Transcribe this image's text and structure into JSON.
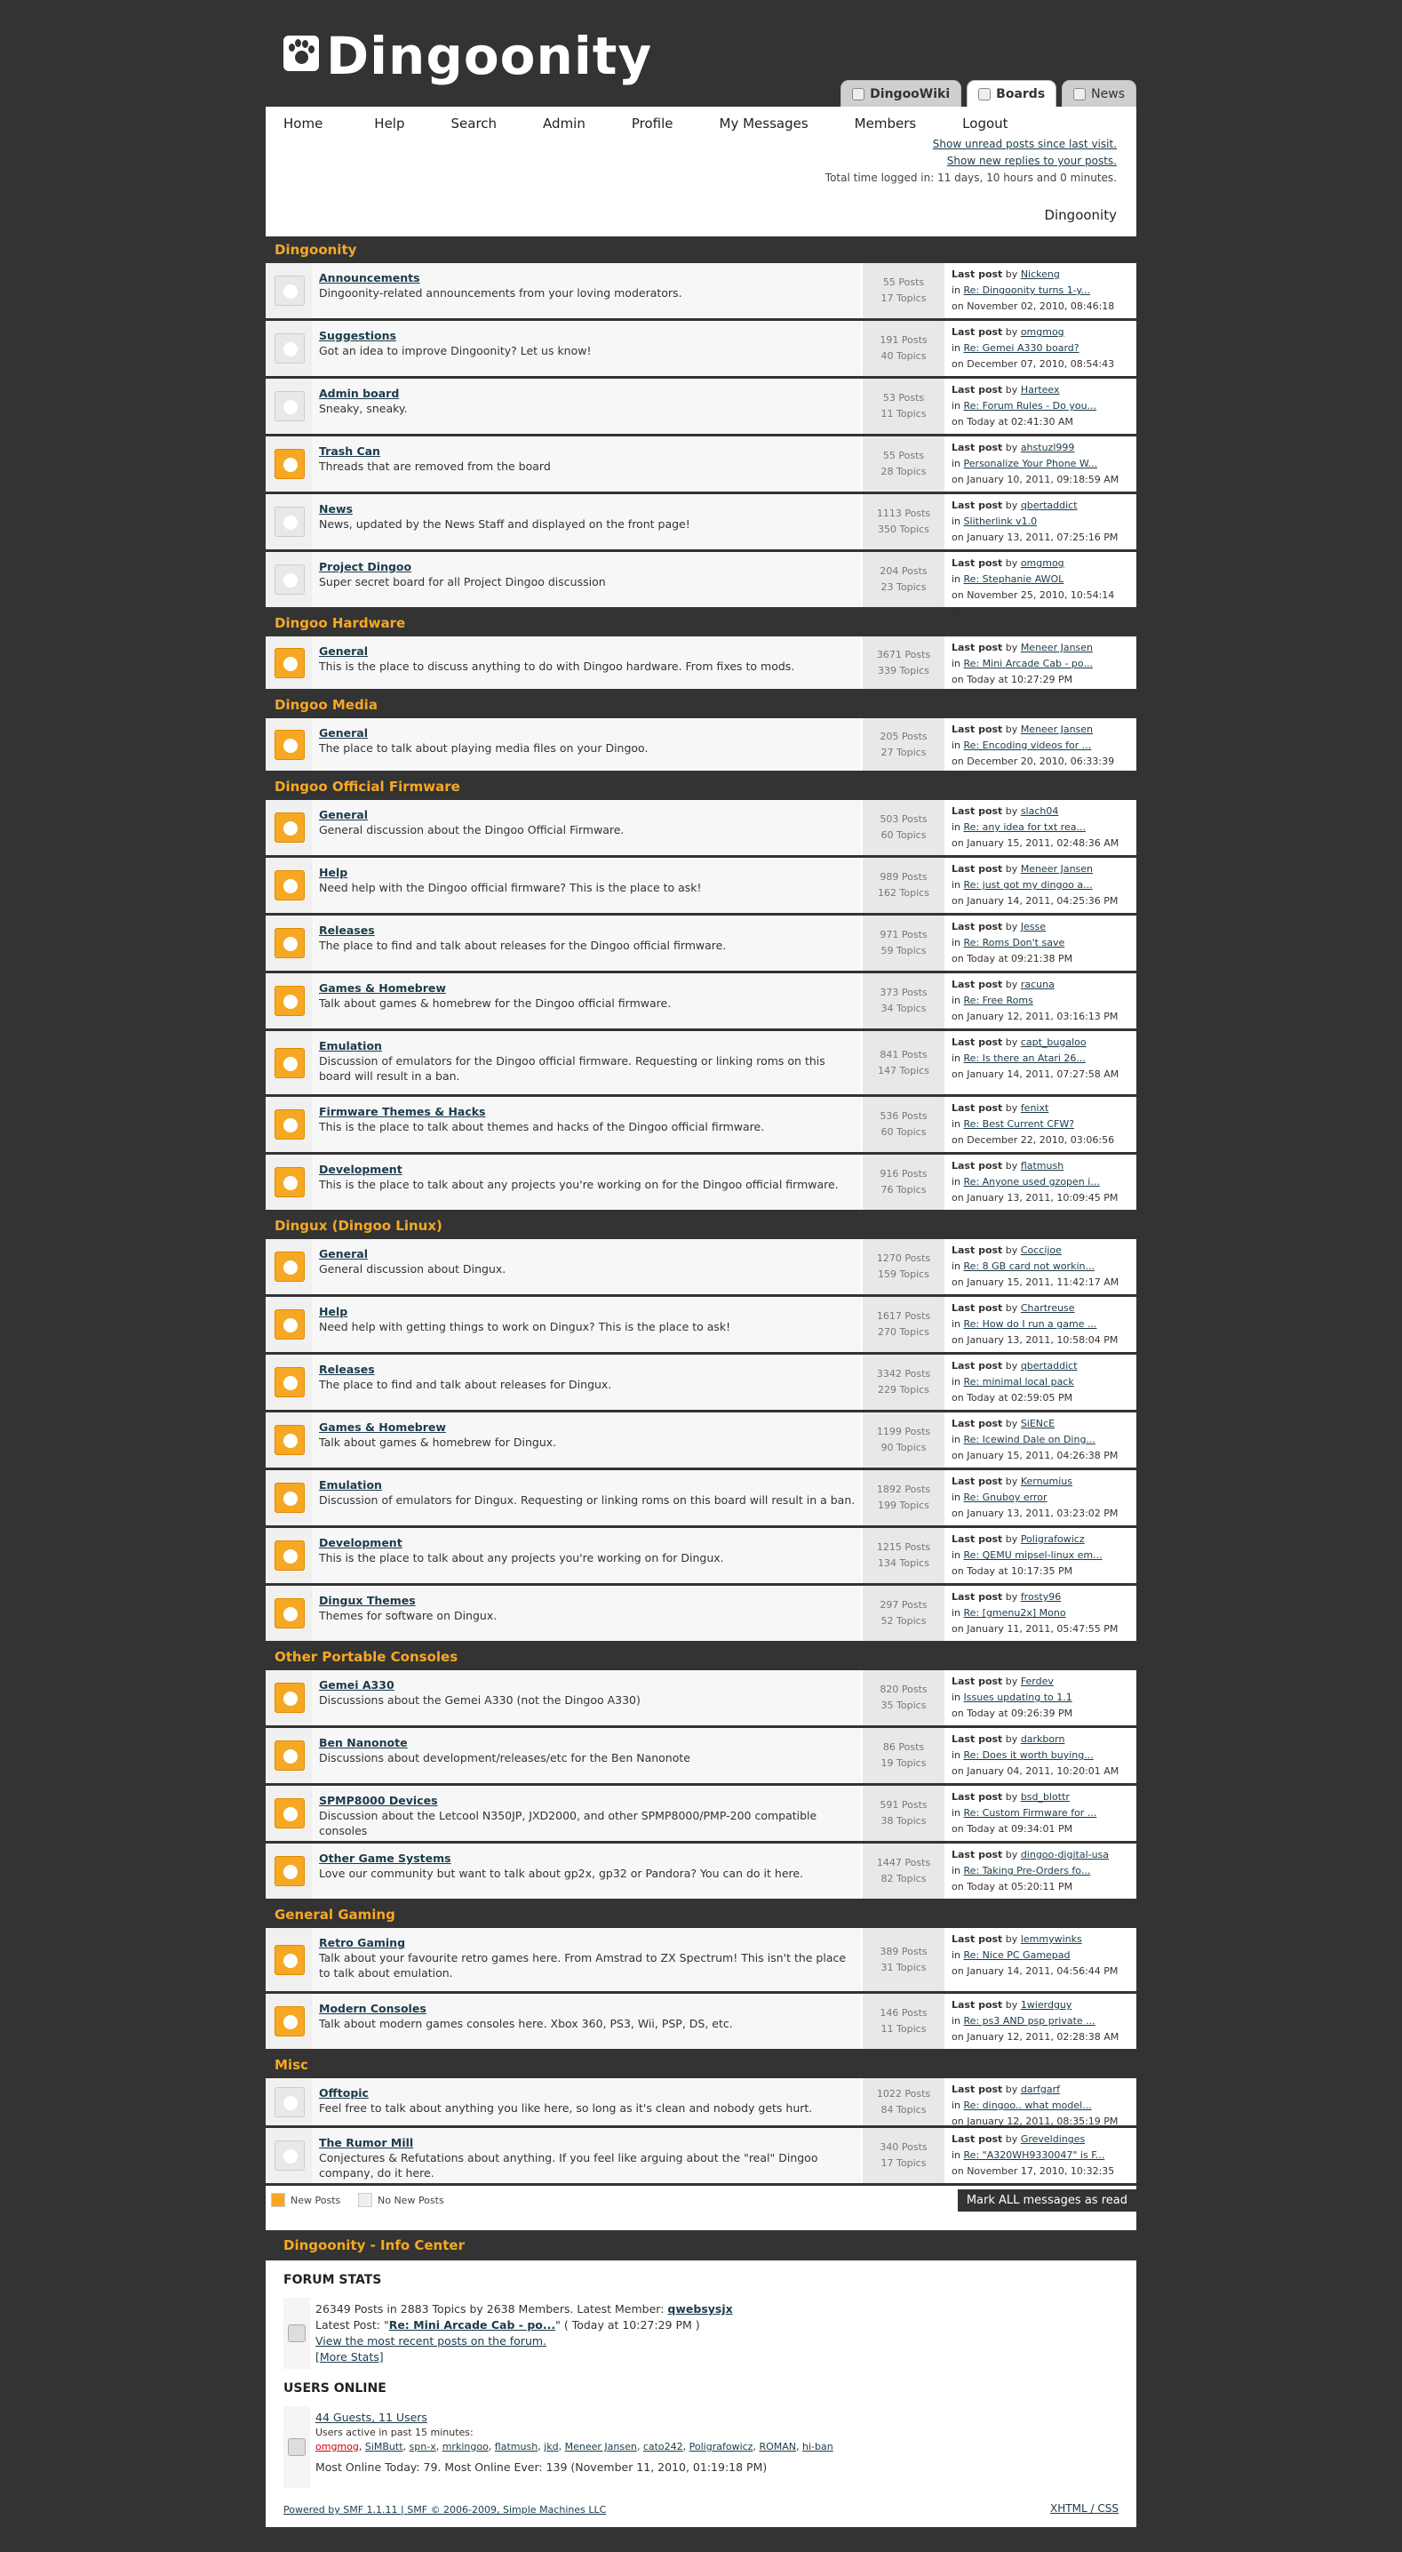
{
  "site": {
    "title": "Dingoonity"
  },
  "site_tabs": [
    "DingooWiki",
    "Boards",
    "News"
  ],
  "menu": [
    "Home",
    "Help",
    "Search",
    "Admin",
    "Profile",
    "My Messages",
    "Members",
    "Logout"
  ],
  "top": {
    "unread": "Show unread posts since last visit.",
    "replies": "Show new replies to your posts.",
    "time": "Total time logged in: 11 days, 10 hours and 0 minutes.",
    "crumb": "Dingoonity"
  },
  "last_post_label": "Last post",
  "categories": [
    {
      "name": "Dingoonity",
      "boards": [
        {
          "name": "Announcements",
          "desc": "Dingoonity-related announcements from your loving moderators.",
          "posts": "55 Posts",
          "topics": "17 Topics",
          "user": "Nickeng",
          "topic": "Re: Dingoonity turns 1-y...",
          "date": "on November 02, 2010, 08:46:18 AM",
          "new": false
        },
        {
          "name": "Suggestions",
          "desc": "Got an idea to improve Dingoonity? Let us know!",
          "posts": "191 Posts",
          "topics": "40 Topics",
          "user": "omgmog",
          "topic": "Re: Gemei A330 board?",
          "date": "on December 07, 2010, 08:54:43 AM",
          "new": false
        },
        {
          "name": "Admin board",
          "desc": "Sneaky, sneaky.",
          "posts": "53 Posts",
          "topics": "11 Topics",
          "user": "Harteex",
          "topic": "Re: Forum Rules - Do you...",
          "date": "on Today at 02:41:30 AM",
          "new": false
        },
        {
          "name": "Trash Can",
          "desc": "Threads that are removed from the board",
          "posts": "55 Posts",
          "topics": "28 Topics",
          "user": "ahstuzl999",
          "topic": "Personalize Your Phone W...",
          "date": "on January 10, 2011, 09:18:59 AM",
          "new": true
        },
        {
          "name": "News",
          "desc": "News, updated by the News Staff and displayed on the front page!",
          "posts": "1113 Posts",
          "topics": "350 Topics",
          "user": "qbertaddict",
          "topic": "Slitherlink v1.0",
          "date": "on January 13, 2011, 07:25:16 PM",
          "new": false
        },
        {
          "name": "Project Dingoo",
          "desc": "Super secret board for all Project Dingoo discussion",
          "posts": "204 Posts",
          "topics": "23 Topics",
          "user": "omgmog",
          "topic": "Re: Stephanie AWOL",
          "date": "on November 25, 2010, 10:54:14 PM",
          "new": false
        }
      ]
    },
    {
      "name": "Dingoo Hardware",
      "boards": [
        {
          "name": "General",
          "desc": "This is the place to discuss anything to do with Dingoo hardware. From fixes to mods.",
          "posts": "3671 Posts",
          "topics": "339 Topics",
          "user": "Meneer Jansen",
          "topic": "Re: Mini Arcade Cab - po...",
          "date": "on Today at 10:27:29 PM",
          "new": true
        }
      ]
    },
    {
      "name": "Dingoo Media",
      "boards": [
        {
          "name": "General",
          "desc": "The place to talk about playing media files on your Dingoo.",
          "posts": "205 Posts",
          "topics": "27 Topics",
          "user": "Meneer Jansen",
          "topic": "Re: Encoding videos for ...",
          "date": "on December 20, 2010, 06:33:39 PM",
          "new": true
        }
      ]
    },
    {
      "name": "Dingoo Official Firmware",
      "boards": [
        {
          "name": "General",
          "desc": "General discussion about the Dingoo Official Firmware.",
          "posts": "503 Posts",
          "topics": "60 Topics",
          "user": "slach04",
          "topic": "Re: any idea for txt rea...",
          "date": "on January 15, 2011, 02:48:36 AM",
          "new": true
        },
        {
          "name": "Help",
          "desc": "Need help with the Dingoo official firmware? This is the place to ask!",
          "posts": "989 Posts",
          "topics": "162 Topics",
          "user": "Meneer Jansen",
          "topic": "Re: just got my dingoo a...",
          "date": "on January 14, 2011, 04:25:36 PM",
          "new": true
        },
        {
          "name": "Releases",
          "desc": "The place to find and talk about releases for the Dingoo official firmware.",
          "posts": "971 Posts",
          "topics": "59 Topics",
          "user": "Jesse",
          "topic": "Re: Roms Don't save",
          "date": "on Today at 09:21:38 PM",
          "new": true
        },
        {
          "name": "Games & Homebrew",
          "desc": "Talk about games & homebrew for the Dingoo official firmware.",
          "posts": "373 Posts",
          "topics": "34 Topics",
          "user": "racuna",
          "topic": "Re: Free Roms",
          "date": "on January 12, 2011, 03:16:13 PM",
          "new": true
        },
        {
          "name": "Emulation",
          "desc": "Discussion of emulators for the Dingoo official firmware. Requesting or linking roms on this board will result in a ban.",
          "posts": "841 Posts",
          "topics": "147 Topics",
          "user": "capt_bugaloo",
          "topic": "Re: Is there an Atari 26...",
          "date": "on January 14, 2011, 07:27:58 AM",
          "new": true
        },
        {
          "name": "Firmware Themes & Hacks",
          "desc": "This is the place to talk about themes and hacks of the Dingoo official firmware.",
          "posts": "536 Posts",
          "topics": "60 Topics",
          "user": "fenixt",
          "topic": "Re: Best Current CFW?",
          "date": "on December 22, 2010, 03:06:56 PM",
          "new": true
        },
        {
          "name": "Development",
          "desc": "This is the place to talk about any projects you're working on for the Dingoo official firmware.",
          "posts": "916 Posts",
          "topics": "76 Topics",
          "user": "flatmush",
          "topic": "Re: Anyone used gzopen i...",
          "date": "on January 13, 2011, 10:09:45 PM",
          "new": true
        }
      ]
    },
    {
      "name": "Dingux (Dingoo Linux)",
      "boards": [
        {
          "name": "General",
          "desc": "General discussion about Dingux.",
          "posts": "1270 Posts",
          "topics": "159 Topics",
          "user": "Coccijoe",
          "topic": "Re: 8 GB card not workin...",
          "date": "on January 15, 2011, 11:42:17 AM",
          "new": true
        },
        {
          "name": "Help",
          "desc": "Need help with getting things to work on Dingux? This is the place to ask!",
          "posts": "1617 Posts",
          "topics": "270 Topics",
          "user": "Chartreuse",
          "topic": "Re: How do I run a game ...",
          "date": "on January 13, 2011, 10:58:04 PM",
          "new": true
        },
        {
          "name": "Releases",
          "desc": "The place to find and talk about releases for Dingux.",
          "posts": "3342 Posts",
          "topics": "229 Topics",
          "user": "qbertaddict",
          "topic": "Re: minimal local pack",
          "date": "on Today at 02:59:05 PM",
          "new": true
        },
        {
          "name": "Games & Homebrew",
          "desc": "Talk about games & homebrew for Dingux.",
          "posts": "1199 Posts",
          "topics": "90 Topics",
          "user": "SiENcE",
          "topic": "Re: Icewind Dale on Ding...",
          "date": "on January 15, 2011, 04:26:38 PM",
          "new": true
        },
        {
          "name": "Emulation",
          "desc": "Discussion of emulators for Dingux. Requesting or linking roms on this board will result in a ban.",
          "posts": "1892 Posts",
          "topics": "199 Topics",
          "user": "Kernumius",
          "topic": "Re: Gnuboy error",
          "date": "on January 13, 2011, 03:23:02 PM",
          "new": true
        },
        {
          "name": "Development",
          "desc": "This is the place to talk about any projects you're working on for Dingux.",
          "posts": "1215 Posts",
          "topics": "134 Topics",
          "user": "Poligrafowicz",
          "topic": "Re: QEMU mipsel-linux em...",
          "date": "on Today at 10:17:35 PM",
          "new": true
        },
        {
          "name": "Dingux Themes",
          "desc": "Themes for software on Dingux.",
          "posts": "297 Posts",
          "topics": "52 Topics",
          "user": "frosty96",
          "topic": "Re: [gmenu2x] Mono",
          "date": "on January 11, 2011, 05:47:55 PM",
          "new": true
        }
      ]
    },
    {
      "name": "Other Portable Consoles",
      "boards": [
        {
          "name": "Gemei A330",
          "desc": "Discussions about the Gemei A330 (not the Dingoo A330)",
          "posts": "820 Posts",
          "topics": "35 Topics",
          "user": "Ferdev",
          "topic": "Issues updating to 1.1",
          "date": "on Today at 09:26:39 PM",
          "new": true
        },
        {
          "name": "Ben Nanonote",
          "desc": "Discussions about development/releases/etc for the Ben Nanonote",
          "posts": "86 Posts",
          "topics": "19 Topics",
          "user": "darkborn",
          "topic": "Re: Does it worth buying...",
          "date": "on January 04, 2011, 10:20:01 AM",
          "new": true
        },
        {
          "name": "SPMP8000 Devices",
          "desc": "Discussion about the Letcool N350JP, JXD2000, and other SPMP8000/PMP-200 compatible consoles",
          "posts": "591 Posts",
          "topics": "38 Topics",
          "user": "bsd_blottr",
          "topic": "Re: Custom Firmware for ...",
          "date": "on Today at 09:34:01 PM",
          "new": true
        },
        {
          "name": "Other Game Systems",
          "desc": "Love our community but want to talk about gp2x, gp32 or Pandora? You can do it here.",
          "posts": "1447 Posts",
          "topics": "82 Topics",
          "user": "dingoo-digital-usa",
          "topic": "Re: Taking Pre-Orders fo...",
          "date": "on Today at 05:20:11 PM",
          "new": true
        }
      ]
    },
    {
      "name": "General Gaming",
      "boards": [
        {
          "name": "Retro Gaming",
          "desc": "Talk about your favourite retro games here. From Amstrad to ZX Spectrum! This isn't the place to talk about emulation.",
          "posts": "389 Posts",
          "topics": "31 Topics",
          "user": "lemmywinks",
          "topic": "Re: Nice PC Gamepad",
          "date": "on January 14, 2011, 04:56:44 PM",
          "new": true
        },
        {
          "name": "Modern Consoles",
          "desc": "Talk about modern games consoles here. Xbox 360, PS3, Wii, PSP, DS, etc.",
          "posts": "146 Posts",
          "topics": "11 Topics",
          "user": "1wierdguy",
          "topic": "Re: ps3 AND psp private ...",
          "date": "on January 12, 2011, 02:28:38 AM",
          "new": true
        }
      ]
    },
    {
      "name": "Misc",
      "boards": [
        {
          "name": "Offtopic",
          "desc": "Feel free to talk about anything you like here, so long as it's clean and nobody gets hurt.",
          "posts": "1022 Posts",
          "topics": "84 Topics",
          "user": "darfgarf",
          "topic": "Re: dingoo.. what model...",
          "date": "on January 12, 2011, 08:35:19 PM",
          "new": false
        },
        {
          "name": "The Rumor Mill",
          "desc": "Conjectures & Refutations about anything. If you feel like arguing about the \"real\" Dingoo company, do it here.",
          "posts": "340 Posts",
          "topics": "17 Topics",
          "user": "Greveldinges",
          "topic": "Re: \"A320WH9330047\" is F...",
          "date": "on November 17, 2010, 10:32:35 PM",
          "new": false
        }
      ]
    }
  ],
  "legend": {
    "new": "New Posts",
    "nonew": "No New Posts",
    "mark": "Mark ALL messages as read"
  },
  "infocenter": {
    "title": "Dingoonity - Info Center",
    "stats_h": "FORUM STATS",
    "stats_line": "26349 Posts in 2883 Topics by 2638 Members. Latest Member:",
    "latest_member": "qwebsysjx",
    "latest_post_label": "Latest Post:",
    "latest_post": "Re: Mini Arcade Cab - po...",
    "latest_post_when": "( Today at 10:27:29 PM )",
    "recent": "View the most recent posts on the forum.",
    "more": "[More Stats]",
    "online_h": "USERS ONLINE",
    "guests": "44 Guests, 11 Users",
    "active": "Users active in past 15 minutes:",
    "users": [
      "omgmog",
      "SiMButt",
      "spn-x",
      "mrkingoo",
      "flatmush",
      "jkd",
      "Meneer Jansen",
      "cato242",
      "Poligrafowicz",
      "ROMAN",
      "hi-ban"
    ],
    "most": "Most Online Today: 79. Most Online Ever: 139 (November 11, 2010, 01:19:18 PM)"
  },
  "footer": {
    "powered": "Powered by SMF 1.1.11",
    "sep": "|",
    "copy": "SMF © 2006-2009, Simple Machines LLC",
    "xhtml": "XHTML",
    "slash": "/",
    "css": "CSS"
  }
}
